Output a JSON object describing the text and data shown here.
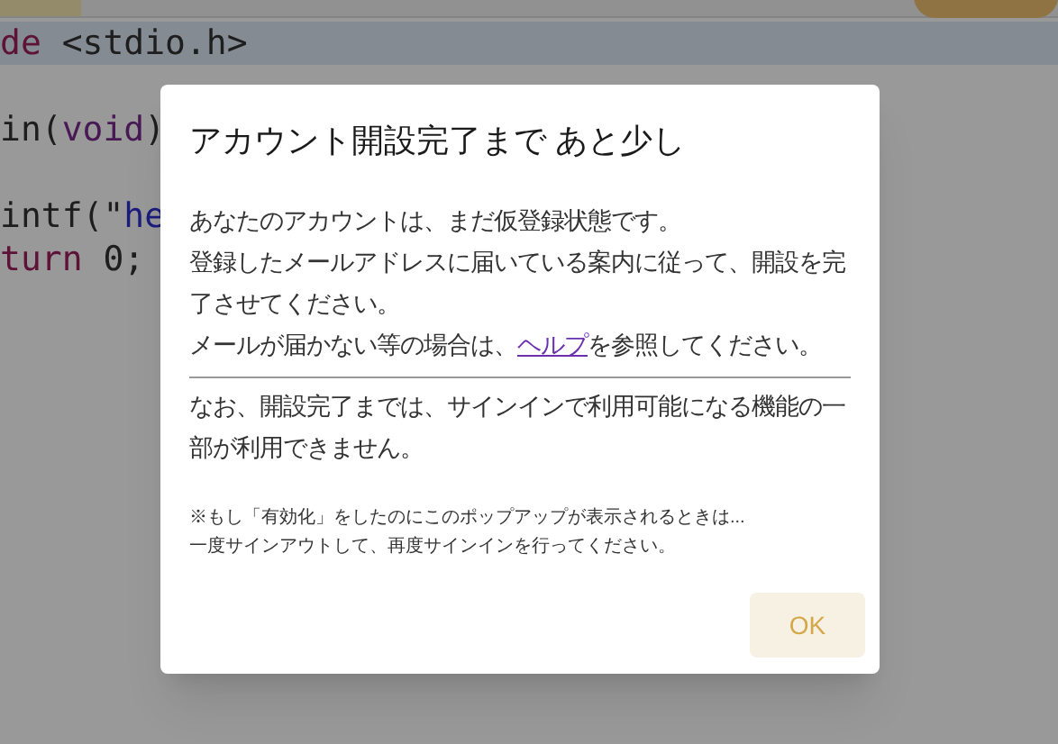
{
  "editor": {
    "lines": [
      {
        "highlighted": true,
        "tokens": [
          {
            "kind": "keyword",
            "text": "de"
          },
          {
            "kind": "plain",
            "text": " <stdio.h>"
          }
        ]
      },
      {
        "highlighted": false
      },
      {
        "highlighted": false,
        "tokens": [
          {
            "kind": "plain",
            "text": "in("
          },
          {
            "kind": "type",
            "text": "void"
          },
          {
            "kind": "plain",
            "text": ")"
          }
        ]
      },
      {
        "highlighted": false
      },
      {
        "highlighted": false,
        "tokens": [
          {
            "kind": "plain",
            "text": "intf(\""
          },
          {
            "kind": "string",
            "text": "he"
          }
        ]
      },
      {
        "highlighted": false,
        "tokens": [
          {
            "kind": "keyword",
            "text": "turn"
          },
          {
            "kind": "plain",
            "text": " 0;"
          }
        ]
      }
    ]
  },
  "dialog": {
    "title": "アカウント開設完了まで あと少し",
    "message_lines": [
      {
        "text": "あなたのアカウントは、まだ仮登録状態です。"
      },
      {
        "text": "登録したメールアドレスに届いている案内に従って、開設を完了させてください。"
      },
      {
        "text": "メールが届かない等の場合は、",
        "link": "ヘルプ",
        "after": "を参照してください。"
      }
    ],
    "notice": "なお、開設完了までは、サインインで利用可能になる機能の一部が利用できません。",
    "footnote_lines": [
      "※もし「有効化」をしたのにこのポップアップが表示されるときは...",
      "一度サインアウトして、再度サインインを行ってください。"
    ],
    "ok_button": "OK"
  }
}
